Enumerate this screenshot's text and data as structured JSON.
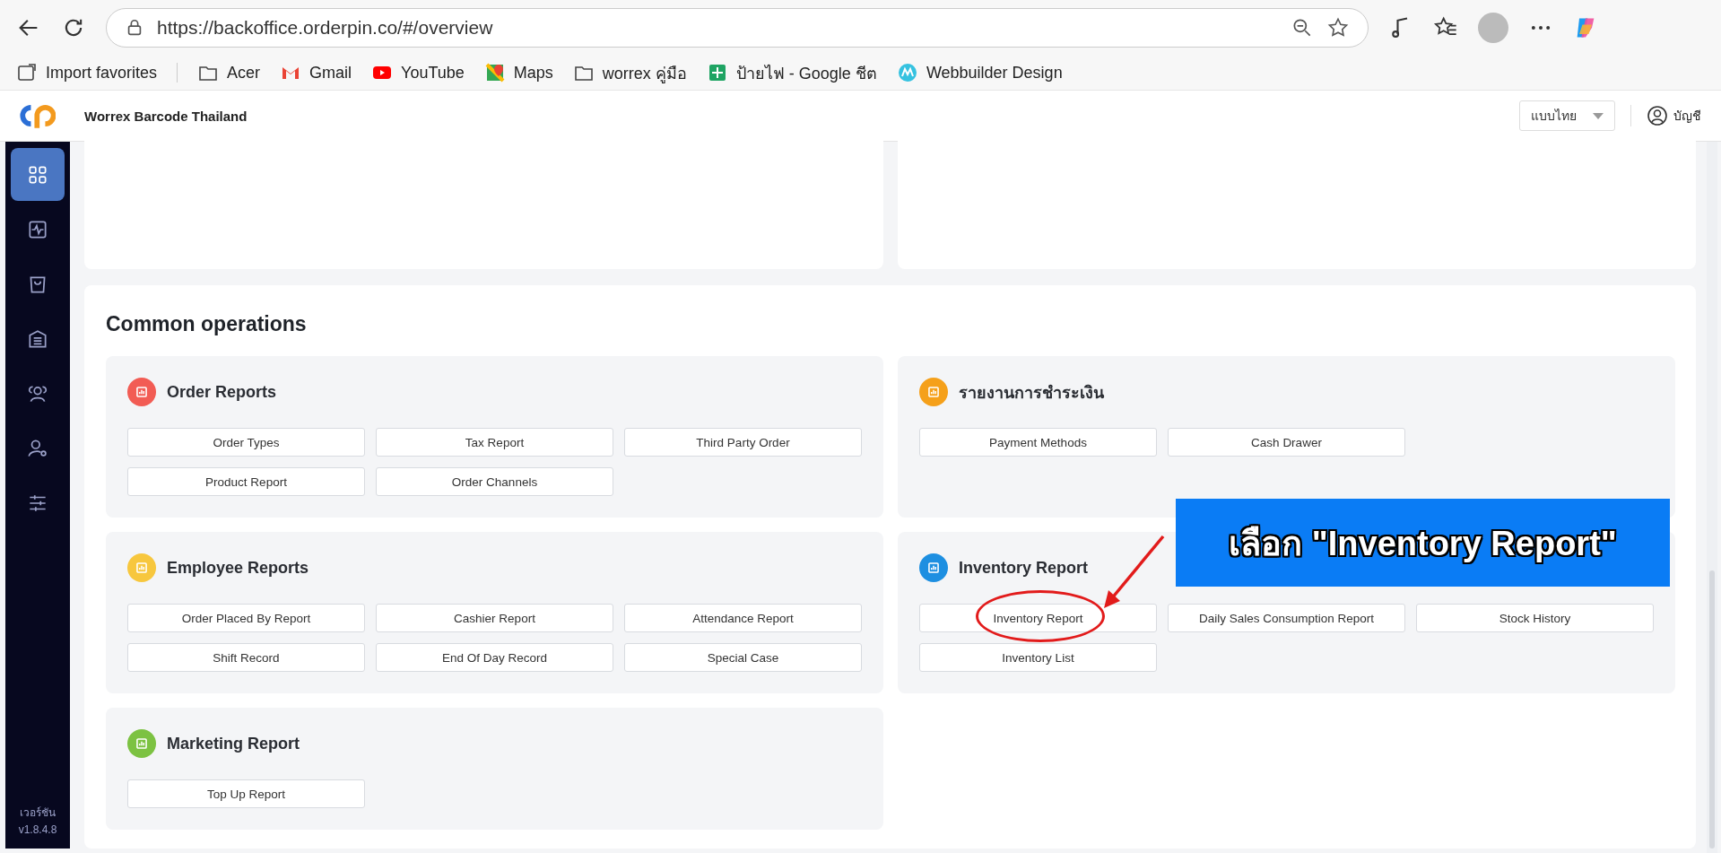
{
  "browser": {
    "url": "https://backoffice.orderpin.co/#/overview",
    "bookmarks": [
      {
        "label": "Import favorites",
        "kind": "import"
      },
      {
        "label": "Acer",
        "kind": "folder"
      },
      {
        "label": "Gmail",
        "kind": "gmail"
      },
      {
        "label": "YouTube",
        "kind": "youtube"
      },
      {
        "label": "Maps",
        "kind": "maps"
      },
      {
        "label": "worrex คู่มือ",
        "kind": "folder"
      },
      {
        "label": "ป้ายไฟ - Google ชีต",
        "kind": "sheets"
      },
      {
        "label": "Webbuilder Design",
        "kind": "web"
      }
    ]
  },
  "header": {
    "title": "Worrex Barcode Thailand",
    "language": "แบบไทย",
    "account": "บัญชี"
  },
  "sidebar": {
    "items": [
      {
        "kind": "grid",
        "selected": true
      },
      {
        "kind": "activity",
        "selected": false
      },
      {
        "kind": "bag",
        "selected": false
      },
      {
        "kind": "warehouse",
        "selected": false
      },
      {
        "kind": "users",
        "selected": false
      },
      {
        "kind": "user-gear",
        "selected": false
      },
      {
        "kind": "sliders",
        "selected": false
      }
    ],
    "version_label": "เวอร์ชัน",
    "version": "v1.8.4.8"
  },
  "common_operations": {
    "title": "Common operations",
    "groups": [
      {
        "title": "Order Reports",
        "color": "#f25c54",
        "buttons": [
          "Order Types",
          "Tax Report",
          "Third Party Order",
          "Product Report",
          "Order Channels"
        ]
      },
      {
        "title": "รายงานการชำระเงิน",
        "color": "#f5a01a",
        "buttons": [
          "Payment Methods",
          "Cash Drawer"
        ]
      },
      {
        "title": "Employee Reports",
        "color": "#f7c73e",
        "buttons": [
          "Order Placed By Report",
          "Cashier Report",
          "Attendance Report",
          "Shift Record",
          "End Of Day Record",
          "Special Case"
        ]
      },
      {
        "title": "Inventory Report",
        "color": "#1d8fe1",
        "buttons": [
          "Inventory Report",
          "Daily Sales Consumption Report",
          "Stock History",
          "Inventory List"
        ]
      },
      {
        "title": "Marketing Report",
        "color": "#7cc242",
        "buttons": [
          "Top Up Report"
        ]
      }
    ]
  },
  "annotation": {
    "text": "เลือก \"Inventory Report\""
  }
}
